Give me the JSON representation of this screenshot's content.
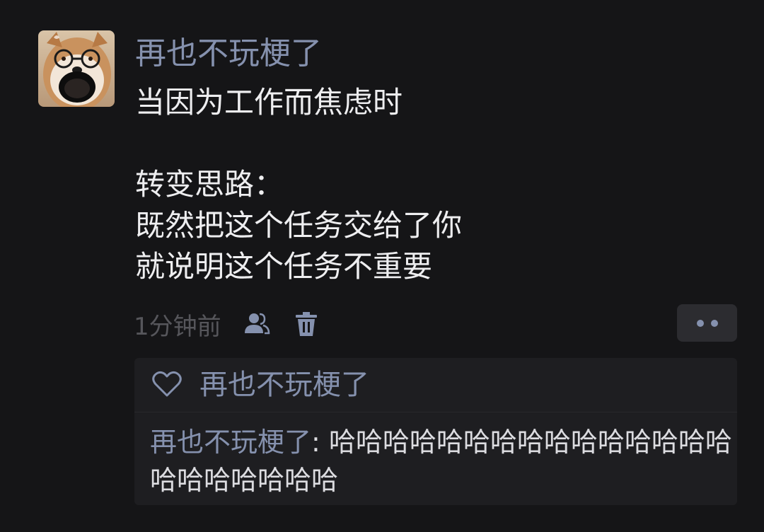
{
  "post": {
    "author": "再也不玩梗了",
    "lines": [
      "当因为工作而焦虑时",
      "",
      "转变思路：",
      "既然把这个任务交给了你",
      "就说明这个任务不重要"
    ],
    "timestamp": "1分钟前",
    "visibility_icon": "friends-icon",
    "delete_icon": "trash-icon",
    "more_icon": "more-dots-icon"
  },
  "likes": {
    "icon": "heart-icon",
    "names": "再也不玩梗了"
  },
  "comments": [
    {
      "author": "再也不玩梗了",
      "separator": ": ",
      "text": "哈哈哈哈哈哈哈哈哈哈哈哈哈哈哈哈哈哈哈哈哈哈"
    }
  ],
  "colors": {
    "background": "#151517",
    "name_link": "#8591ae",
    "body_text": "#eeeef0",
    "muted_text": "#56565b",
    "panel_bg": "#1e1e21"
  }
}
